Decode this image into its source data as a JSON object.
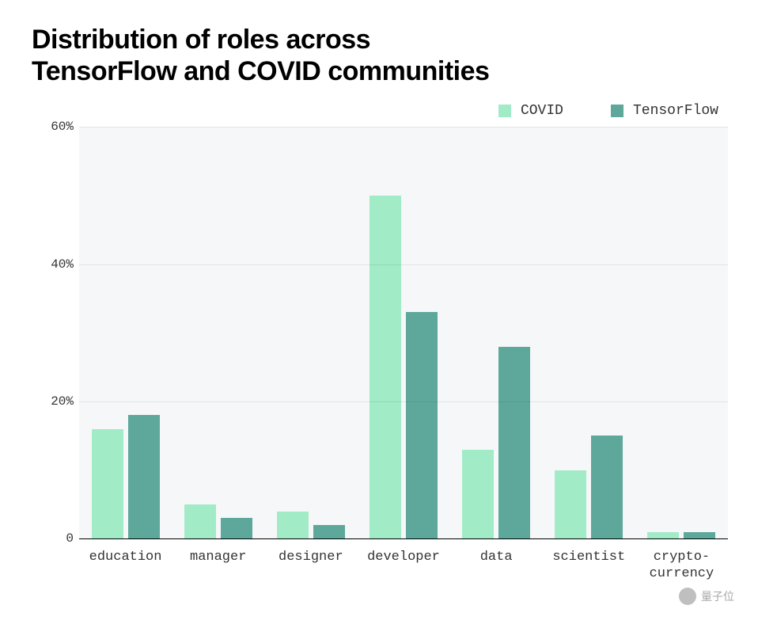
{
  "chart_data": {
    "type": "bar",
    "title": "Distribution of roles across\nTensorFlow and COVID communities",
    "categories": [
      "education",
      "manager",
      "designer",
      "developer",
      "data",
      "scientist",
      "crypto-\ncurrency"
    ],
    "series": [
      {
        "name": "COVID",
        "color": "#a2ebc7",
        "values": [
          16,
          5,
          4,
          50,
          13,
          10,
          1
        ]
      },
      {
        "name": "TensorFlow",
        "color": "#5da89b",
        "values": [
          18,
          3,
          2,
          33,
          28,
          15,
          1
        ]
      }
    ],
    "ylabel": "",
    "xlabel": "",
    "ylim": [
      0,
      60
    ],
    "yticks": [
      0,
      20,
      40,
      60
    ],
    "ytick_suffix": "%",
    "legend_position": "top-right"
  },
  "watermark": {
    "label": "量子位"
  }
}
